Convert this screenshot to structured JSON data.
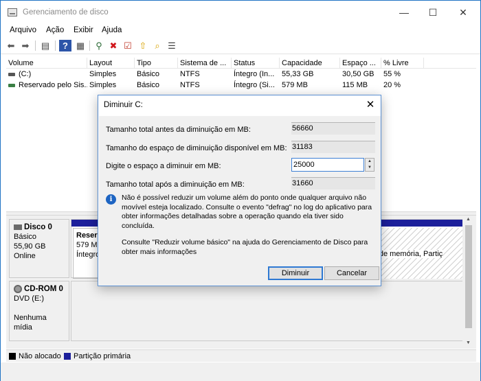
{
  "window": {
    "title": "Gerenciamento de disco",
    "minimize": "—",
    "maximize": "☐",
    "close": "✕"
  },
  "menu": [
    "Arquivo",
    "Ação",
    "Exibir",
    "Ajuda"
  ],
  "toolbar": {
    "icons": [
      "back-icon",
      "forward-icon",
      "console-tree-icon",
      "help-icon",
      "properties-icon",
      "connect-icon",
      "delete-icon",
      "checkmark-icon",
      "up-folder-icon",
      "search-folder-icon",
      "list-icon"
    ],
    "glyphs": [
      "⬅",
      "➡",
      "▤",
      "?",
      "▦",
      "⚲",
      "✖",
      "☑",
      "⇧",
      "⌕",
      "☰"
    ]
  },
  "columns": [
    "Volume",
    "Layout",
    "Tipo",
    "Sistema de ...",
    "Status",
    "Capacidade",
    "Espaço ...",
    "% Livre"
  ],
  "volumes": [
    [
      "(C:)",
      "Simples",
      "Básico",
      "NTFS",
      "Íntegro (In...",
      "55,33 GB",
      "30,50 GB",
      "55 %"
    ],
    [
      "Reservado pelo Sis...",
      "Simples",
      "Básico",
      "NTFS",
      "Íntegro (Si...",
      "579 MB",
      "115 MB",
      "20 %"
    ]
  ],
  "disks": {
    "disk0": {
      "name": "Disco 0",
      "type": "Básico",
      "size": "55,90 GB",
      "state": "Online",
      "part1": {
        "name": "Reserv",
        "size": "579 M",
        "status": "Íntegro"
      },
      "part2": {
        "tail": "pejo de memória, Partiç"
      }
    },
    "cd0": {
      "name": "CD-ROM 0",
      "drive": "DVD (E:)",
      "media": "Nenhuma mídia"
    }
  },
  "legend": {
    "unallocated": "Não alocado",
    "primary": "Partição primária",
    "colors": {
      "unallocated": "#000000",
      "primary": "#1c1f9b"
    }
  },
  "dialog": {
    "title": "Diminuir C:",
    "close": "✕",
    "total_before_label": "Tamanho total antes da diminuição em MB:",
    "total_before": "56660",
    "available_label": "Tamanho do espaço de diminuição disponível em MB:",
    "available": "31183",
    "amount_label": "Digite o espaço a diminuir em MB:",
    "amount": "25000",
    "total_after_label": "Tamanho total após a diminuição em MB:",
    "total_after": "31660",
    "info": "Não é possível reduzir um volume além do ponto onde qualquer arquivo não movível esteja localizado. Consulte o evento \"defrag\" no log do aplicativo para obter informações detalhadas sobre a operação quando ela tiver sido concluída.",
    "help": "Consulte \"Reduzir volume básico\" na ajuda do Gerenciamento de Disco para obter mais informações",
    "ok": "Diminuir",
    "cancel": "Cancelar"
  }
}
